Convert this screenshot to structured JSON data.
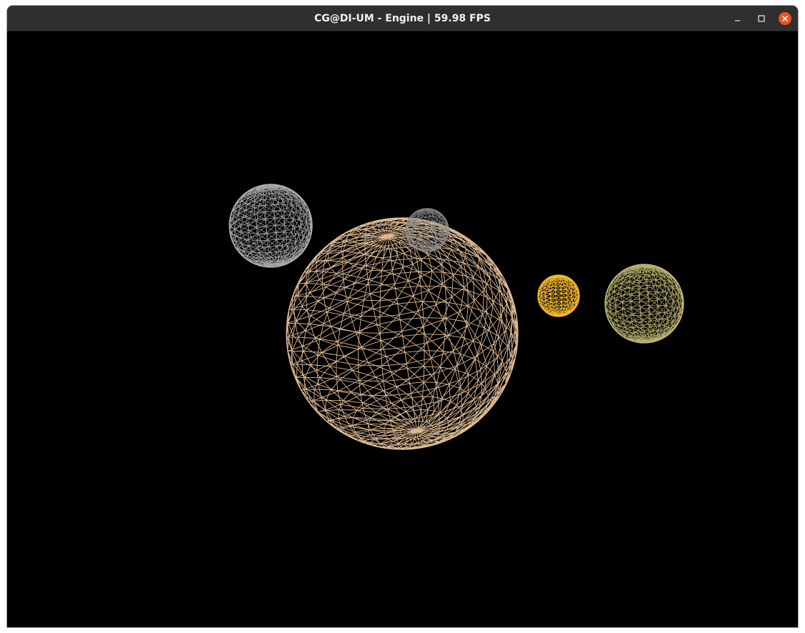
{
  "window": {
    "title": "CG@DI-UM - Engine | 59.98 FPS",
    "controls": {
      "minimize_icon": "minimize-icon",
      "maximize_icon": "maximize-icon",
      "close_icon": "close-icon",
      "close_color": "#e95420"
    }
  },
  "scene": {
    "background": "#000000",
    "render_mode": "wireframe",
    "bodies": [
      {
        "id": "large-sphere",
        "color": "#e8c39a"
      },
      {
        "id": "grey-sphere",
        "color": "#b8b8b8"
      },
      {
        "id": "small-grey-sphere",
        "color": "#8a8a8a"
      },
      {
        "id": "orange-sphere",
        "color": "#f5b82e"
      },
      {
        "id": "olive-sphere",
        "color": "#c9c07a"
      }
    ]
  }
}
